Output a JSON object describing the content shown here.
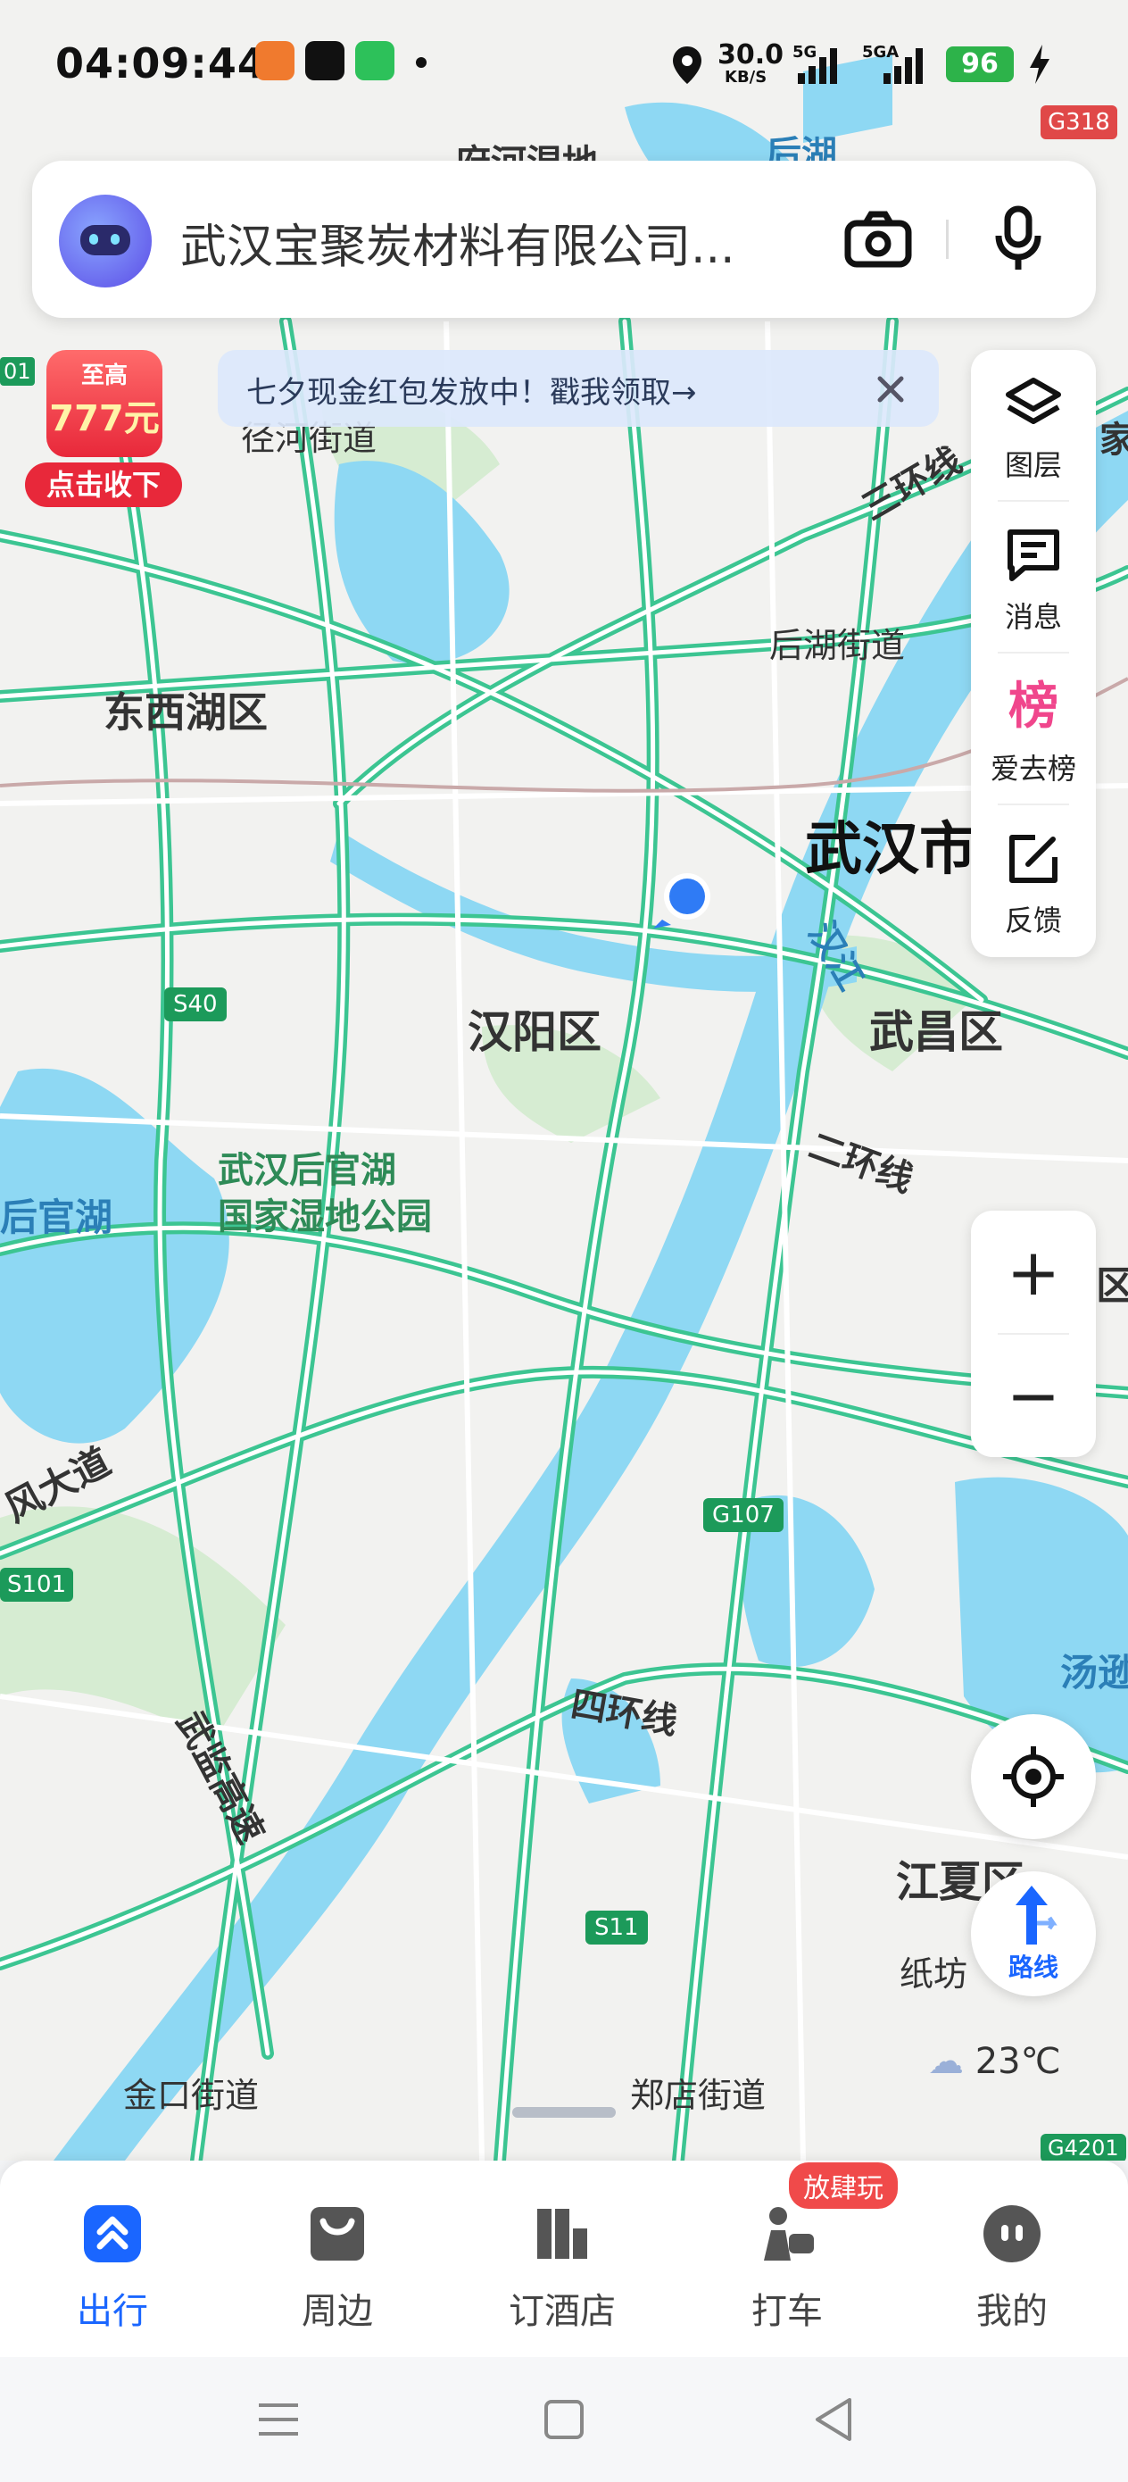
{
  "status_bar": {
    "time": "04:09:44",
    "net_speed": "30.0",
    "net_unit": "KB/S",
    "signal1": "5G",
    "signal2": "5GA",
    "battery": "96"
  },
  "search": {
    "text": "武汉宝聚炭材料有限公司..."
  },
  "banner": {
    "text": "七夕现金红包发放中！戳我领取→"
  },
  "promo": {
    "top": "至高",
    "amount": "777元",
    "action": "点击收下"
  },
  "tools": [
    {
      "label": "图层",
      "icon": "layers-icon"
    },
    {
      "label": "消息",
      "icon": "message-icon"
    },
    {
      "label": "爱去榜",
      "icon": "ranking-icon",
      "glyph": "榜"
    },
    {
      "label": "反馈",
      "icon": "feedback-icon"
    }
  ],
  "zoom": {
    "in": "+",
    "out": "−"
  },
  "route": {
    "label": "路线"
  },
  "weather": {
    "temp": "23℃"
  },
  "map_labels": {
    "fuhe": "府河湿地",
    "houhu_top": "后湖",
    "jinghe": "径河街道",
    "houhu_street": "后湖街道",
    "dongxihu": "东西湖区",
    "wuhan_city": "武汉市",
    "hanjiang": "汉江",
    "hanyang": "汉阳区",
    "wuchang": "武昌区",
    "park1": "武汉后官湖",
    "park2": "国家湿地公园",
    "ring2": "二环线",
    "ring3": "三环线",
    "guanhu": "后官湖",
    "dadao": "风大道",
    "ring4": "四环线",
    "expressway": "武监高速",
    "jiangxia": "江夏区",
    "zhifang": "纸坊",
    "jinkou": "金口街道",
    "zhengdian": "郑店街道",
    "tangxun": "汤逊",
    "qu_edge": "区",
    "jia_edge": "家"
  },
  "road_shields": {
    "g318": "G318",
    "s40": "S40",
    "g107": "G107",
    "s101": "S101",
    "s11": "S11",
    "g4201": "G4201",
    "left": "01"
  },
  "tabs": [
    {
      "label": "出行",
      "icon": "travel-icon",
      "active": true
    },
    {
      "label": "周边",
      "icon": "nearby-icon",
      "active": false
    },
    {
      "label": "订酒店",
      "icon": "hotel-icon",
      "active": false
    },
    {
      "label": "打车",
      "icon": "taxi-icon",
      "active": false
    },
    {
      "label": "我的",
      "icon": "profile-icon",
      "active": false
    }
  ],
  "taxi_badge": "放肆玩",
  "colors": {
    "accent": "#1a66ff",
    "road": "#3cc592",
    "water": "#8ed8f3",
    "green": "#d3ecd0"
  }
}
